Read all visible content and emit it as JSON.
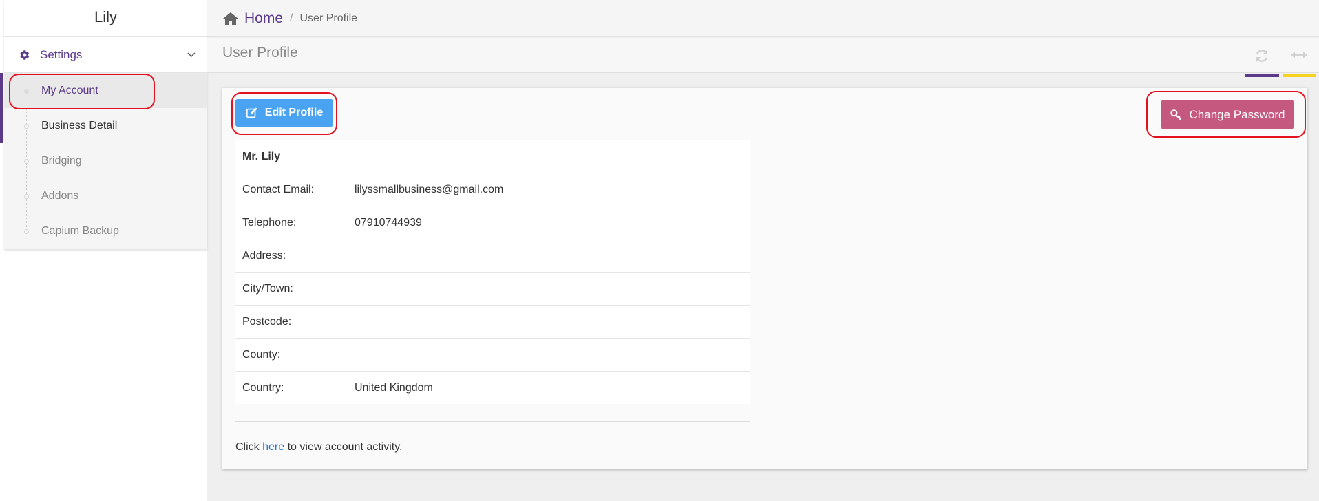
{
  "sidebar": {
    "title": "Lily",
    "settings_label": "Settings",
    "items": [
      {
        "label": "My Account"
      },
      {
        "label": "Business Detail"
      },
      {
        "label": "Bridging"
      },
      {
        "label": "Addons"
      },
      {
        "label": "Capium Backup"
      }
    ]
  },
  "breadcrumb": {
    "home": "Home",
    "separator": "/",
    "current": "User Profile"
  },
  "page": {
    "title": "User Profile"
  },
  "actions": {
    "edit_profile": "Edit Profile",
    "change_password": "Change Password"
  },
  "profile": {
    "name": "Mr. Lily",
    "fields": [
      {
        "label": "Contact Email:",
        "value": "lilyssmallbusiness@gmail.com"
      },
      {
        "label": "Telephone:",
        "value": "07910744939"
      },
      {
        "label": "Address:",
        "value": ""
      },
      {
        "label": "City/Town:",
        "value": ""
      },
      {
        "label": "Postcode:",
        "value": ""
      },
      {
        "label": "County:",
        "value": ""
      },
      {
        "label": "Country:",
        "value": "United Kingdom"
      }
    ]
  },
  "activity": {
    "prefix": "Click",
    "link": "here",
    "suffix": "to view account activity."
  },
  "colors": {
    "brand_purple": "#5b3a8a",
    "edit_button": "#4aa3f0",
    "password_button": "#c5587f",
    "accent_yellow": "#f7d21e",
    "highlight_ring": "#e3101f"
  },
  "icons": {
    "settings": "gear-icon",
    "collapse": "chevron-down-icon",
    "home": "home-icon",
    "refresh": "refresh-icon",
    "expand": "expand-horizontal-icon",
    "edit": "edit-icon",
    "password": "key-icon"
  }
}
